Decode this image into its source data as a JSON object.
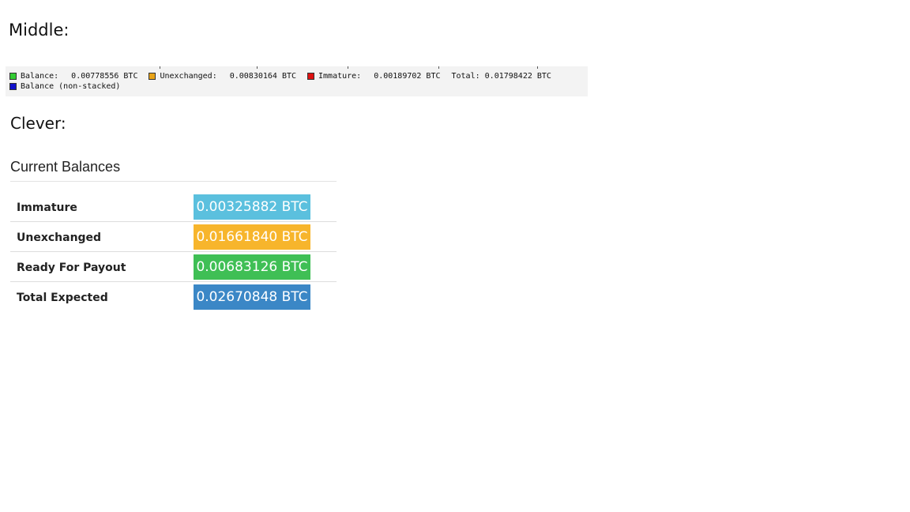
{
  "sections": {
    "middle_title": "Middle:",
    "clever_title": "Clever:"
  },
  "legend": {
    "items": [
      {
        "label": "Balance:",
        "value": "0.00778556 BTC",
        "color": "#33cc33"
      },
      {
        "label": "Unexchanged:",
        "value": "0.00830164 BTC",
        "color": "#e8a317"
      },
      {
        "label": "Immature:",
        "value": "0.00189702 BTC",
        "color": "#dd1111"
      }
    ],
    "total_label": "Total:",
    "total_value": "0.01798422 BTC",
    "second_line": {
      "label": "Balance (non-stacked)",
      "color": "#1111cc"
    }
  },
  "balances": {
    "title": "Current Balances",
    "rows": [
      {
        "label": "Immature",
        "value": "0.00325882 BTC",
        "color": "#5bc0de"
      },
      {
        "label": "Unexchanged",
        "value": "0.01661840 BTC",
        "color": "#f7b52c"
      },
      {
        "label": "Ready For Payout",
        "value": "0.00683126 BTC",
        "color": "#3fbf55"
      },
      {
        "label": "Total Expected",
        "value": "0.02670848 BTC",
        "color": "#3b87c6"
      }
    ]
  }
}
